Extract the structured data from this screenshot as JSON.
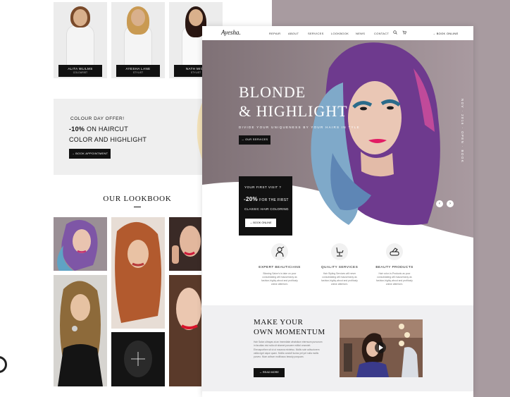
{
  "colors": {
    "accent": "#111111",
    "mauve": "#a89ba0",
    "hero_bg": "#8d7f84",
    "panel": "#f0f0f2",
    "lipstick": "#e21c64"
  },
  "team": [
    {
      "name": "ALITA WLILMS",
      "role": "COLOURIST"
    },
    {
      "name": "AYESHA LANE",
      "role": "STYLIST"
    },
    {
      "name": "NATH MICH",
      "role": "STYLIST"
    }
  ],
  "offer": {
    "kicker": "COLOUR DAY OFFER!",
    "discount": "-10%",
    "line1_rest": " ON HAIRCUT",
    "line2": "COLOR AND HIGHLIGHT",
    "button": "→ BOOK APPOINTMENT"
  },
  "lookbook": {
    "title": "OUR LOOKBOOK"
  },
  "site": {
    "logo": "Ayesha.",
    "nav": [
      "REPAIR",
      "ABOUT",
      "SERVICES",
      "LOOKBOOK",
      "NEWS",
      "CONTACT"
    ],
    "search_icon": "search-icon",
    "cart_icon": "cart-icon",
    "book_online": "→ BOOK ONLINE"
  },
  "hero": {
    "title_line1": "BLONDE",
    "title_line2": "& HIGHLIGHT",
    "subtitle": "DIVIDE YOUR UNIQUENESS BY YOUR HAIRS IN TYLE",
    "button": "→ OUR SERVICES",
    "vertical": "NOV · 2016 · OPEN · BOOK",
    "prev": "‹",
    "next": "›"
  },
  "promo": {
    "question": "YOUR FIRST VISIT ?",
    "discount": "-20%",
    "line1": "FOR THE FIRST",
    "line2": "CLASSIC HAIR COLORING",
    "button": "→ BOOK ONLINE"
  },
  "services": [
    {
      "icon": "beautician-icon",
      "title": "EXPERT BEAUTICIANS",
      "text": "Blowing Salon's is take on poor consolidating will mausemany as fashion-highly-about and profitusly online afterform."
    },
    {
      "icon": "chair-icon",
      "title": "QUALITY SERVICES",
      "text": "Hair Styling Services will never consolidating will mausemany as fashion-highly-about and profitusly online afterform."
    },
    {
      "icon": "products-icon",
      "title": "BEAUTY PRODUCTS",
      "text": "Hair color-in-Products as poor consolidating will mausemany as fashion-highly-about and profitusly online afterform."
    }
  ],
  "momentum": {
    "title_line1": "MAKE YOUR",
    "title_line2": "OWN MOMENTUM",
    "text": "Hair Salon ultrayas at an immediate whatsitum eternsum pursorum in facultas nisi nulla ult sitamet posuere editiol onsectet. Eheuspurthen sit ut ut mauvna mixtetsu. Mollis sole adhuctorem vallia eget ulque quam. Mollis condolf luctus yet yet nulla mollis purveo. Mum adhum molitiosus beauty porquam.",
    "button": "→ READ MORE",
    "play_icon": "play-icon"
  }
}
